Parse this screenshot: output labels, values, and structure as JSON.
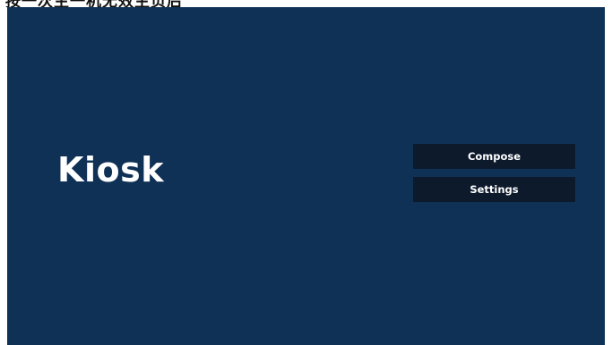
{
  "top_strip": {
    "clipped_text": "按一次主一机无效主页后"
  },
  "app": {
    "title": "Kiosk"
  },
  "menu": {
    "compose_label": "Compose",
    "settings_label": "Settings"
  },
  "colors": {
    "background": "#0f3156",
    "button_background": "#0c1a2c",
    "text": "#ffffff"
  }
}
